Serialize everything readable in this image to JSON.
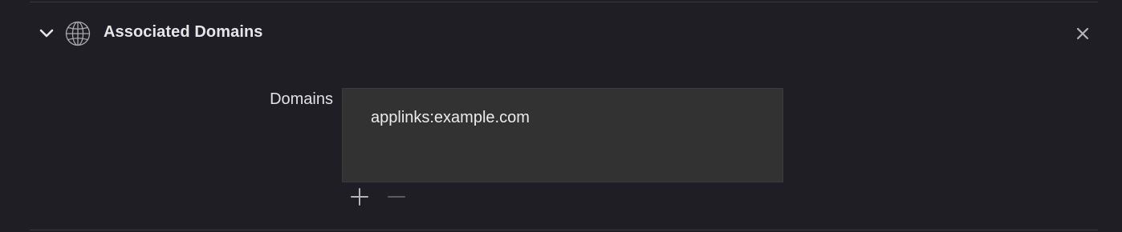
{
  "section": {
    "title": "Associated Domains",
    "icons": {
      "disclosure": "chevron-down-icon",
      "capability": "globe-icon",
      "remove_capability": "close-icon"
    }
  },
  "domains": {
    "label": "Domains",
    "items": [
      "applinks:example.com"
    ],
    "controls": {
      "add": "plus-icon",
      "remove": "minus-icon"
    }
  },
  "colors": {
    "background": "#1f1e25",
    "list_background": "#323232",
    "text": "#e6e6e8",
    "icon": "#b4b4b8",
    "icon_disabled": "#5c5c60"
  }
}
